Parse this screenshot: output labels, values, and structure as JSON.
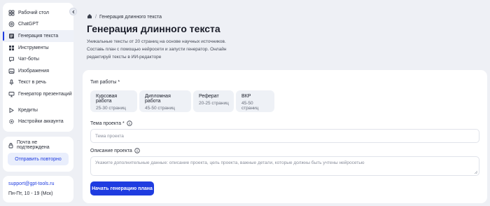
{
  "sidebar": {
    "items": [
      {
        "label": "Рабочий стол",
        "icon": "home-icon"
      },
      {
        "label": "ChatGPT",
        "icon": "chatgpt-icon"
      },
      {
        "label": "Генерация текста",
        "icon": "text-generation-icon",
        "active": true
      },
      {
        "label": "Инструменты",
        "icon": "tools-grid-icon"
      },
      {
        "label": "Чат-боты",
        "icon": "chat-bot-icon"
      },
      {
        "label": "Изображения",
        "icon": "image-icon"
      },
      {
        "label": "Текст в речь",
        "icon": "microphone-icon"
      },
      {
        "label": "Генератор презентаций",
        "icon": "presentation-icon"
      }
    ],
    "bottom_items": [
      {
        "label": "Кредиты",
        "icon": "credits-icon"
      },
      {
        "label": "Настройки аккаунта",
        "icon": "gear-icon"
      }
    ],
    "mail": {
      "status": "Почта не подтверждена",
      "resend_label": "Отправить повторно"
    },
    "support": {
      "email": "support@gpt-tools.ru",
      "hours": "Пн-Пт, 10 - 19 (Мск)"
    }
  },
  "breadcrumb": {
    "current": "Генерация длинного текста"
  },
  "page": {
    "title": "Генерация длинного текста",
    "description": "Уникальные тексты от 20 страниц на основе научных источников. Составь план с помощью нейросети и запусти генератор. Онлайн редактируй тексты в ИИ-редакторе"
  },
  "form": {
    "type_label": "Тип работы *",
    "types": [
      {
        "title": "Курсовая работа",
        "subtitle": "25-30 страниц"
      },
      {
        "title": "Дипломная работа",
        "subtitle": "45-50 страниц"
      },
      {
        "title": "Реферат",
        "subtitle": "20-25 страниц"
      },
      {
        "title": "ВКР",
        "subtitle": "45-50 страниц"
      }
    ],
    "topic_label": "Тема проекта *",
    "topic_placeholder": "Тема проекта",
    "topic_value": "",
    "description_label": "Описание проекта",
    "description_placeholder": "Укажите дополнительные данные: описание проекта, цель проекта, важные детали, которые должны быть учтены нейросетью",
    "description_value": "",
    "submit_label": "Начать генерацию плана"
  },
  "colors": {
    "accent": "#1f3ce0",
    "background": "#eef0f5",
    "card": "#ffffff"
  }
}
